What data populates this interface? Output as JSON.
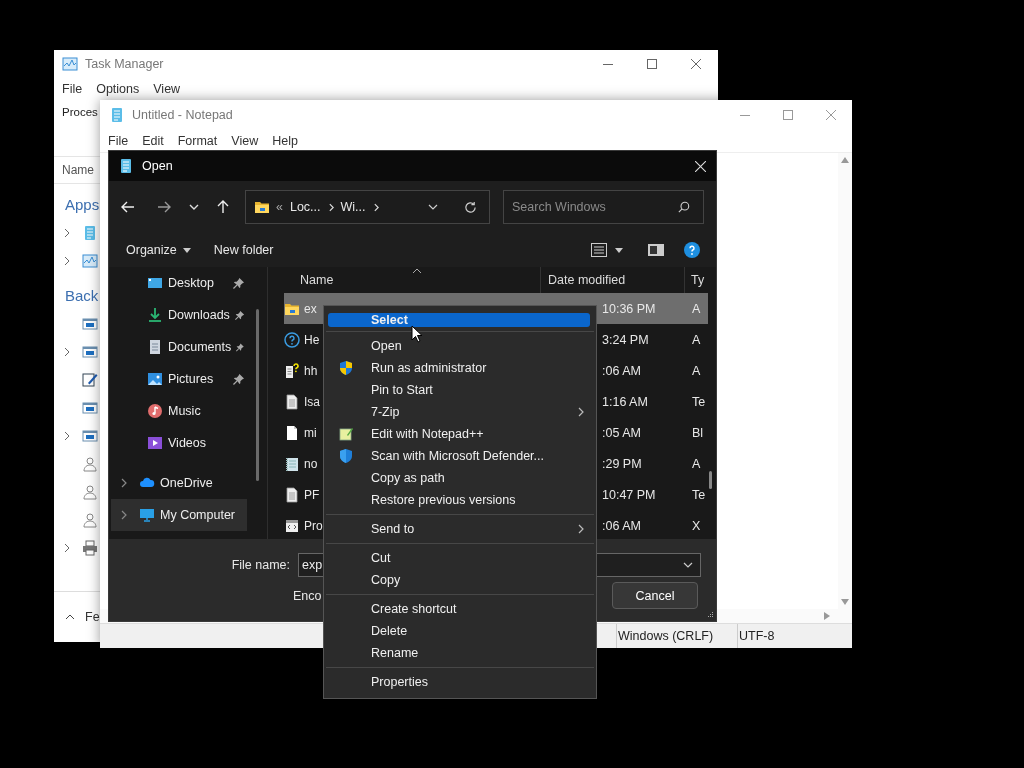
{
  "task_manager": {
    "title": "Task Manager",
    "menu": [
      "File",
      "Options",
      "View"
    ],
    "tab": "Proces",
    "column": "Name",
    "sections": [
      {
        "title": "Apps",
        "rows": [
          {
            "kind": "notepad",
            "expandable": true
          },
          {
            "kind": "chart",
            "expandable": true
          }
        ]
      },
      {
        "title": "Back",
        "rows": [
          {
            "kind": "window",
            "expandable": false
          },
          {
            "kind": "window",
            "expandable": true
          },
          {
            "kind": "editor",
            "expandable": false
          },
          {
            "kind": "window",
            "expandable": false
          },
          {
            "kind": "window",
            "expandable": true
          },
          {
            "kind": "user",
            "expandable": false
          },
          {
            "kind": "user",
            "expandable": false
          },
          {
            "kind": "user",
            "expandable": false
          },
          {
            "kind": "printer",
            "expandable": true
          }
        ]
      }
    ],
    "footer": "Fe"
  },
  "notepad": {
    "title": "Untitled - Notepad",
    "menu": [
      "File",
      "Edit",
      "Format",
      "View",
      "Help"
    ],
    "status": [
      "Windows (CRLF)",
      "UTF-8"
    ]
  },
  "open_dialog": {
    "title": "Open",
    "address": {
      "prefix": "«",
      "segments": [
        "Loc...",
        "Wi..."
      ]
    },
    "search": {
      "placeholder": "Search Windows"
    },
    "toolbar": {
      "organize": "Organize",
      "new_folder": "New folder"
    },
    "nav": [
      {
        "label": "Desktop",
        "kind": "desktop",
        "pinned": true,
        "expandable": false,
        "selected": false
      },
      {
        "label": "Downloads",
        "kind": "downloads",
        "pinned": true,
        "expandable": false,
        "selected": false
      },
      {
        "label": "Documents",
        "kind": "documents",
        "pinned": true,
        "expandable": false,
        "selected": false
      },
      {
        "label": "Pictures",
        "kind": "pictures",
        "pinned": true,
        "expandable": false,
        "selected": false
      },
      {
        "label": "Music",
        "kind": "music",
        "pinned": false,
        "expandable": false,
        "selected": false
      },
      {
        "label": "Videos",
        "kind": "videos",
        "pinned": false,
        "expandable": false,
        "selected": false
      },
      {
        "label": "OneDrive",
        "kind": "cloud",
        "pinned": false,
        "expandable": true,
        "selected": false
      },
      {
        "label": "My Computer",
        "kind": "computer",
        "pinned": false,
        "expandable": true,
        "selected": true
      }
    ],
    "columns": [
      "Name",
      "Date modified",
      "Ty"
    ],
    "files": [
      {
        "name": "ex",
        "date": "10:36 PM",
        "type": "A",
        "kind": "folder",
        "selected": true
      },
      {
        "name": "He",
        "date": "3:24 PM",
        "type": "A",
        "kind": "help",
        "selected": false
      },
      {
        "name": "hh",
        "date": ":06 AM",
        "type": "A",
        "kind": "helpfile",
        "selected": false
      },
      {
        "name": "Isa",
        "date": "1:16 AM",
        "type": "Te",
        "kind": "text",
        "selected": false
      },
      {
        "name": "mi",
        "date": ":05 AM",
        "type": "Bl",
        "kind": "blank",
        "selected": false
      },
      {
        "name": "no",
        "date": ":29 PM",
        "type": "A",
        "kind": "notepadfile",
        "selected": false
      },
      {
        "name": "PF",
        "date": "10:47 PM",
        "type": "Te",
        "kind": "text",
        "selected": false
      },
      {
        "name": "Pro",
        "date": ":06 AM",
        "type": "X",
        "kind": "xml",
        "selected": false
      }
    ],
    "file_name": {
      "label": "File name:",
      "value": "exp"
    },
    "encoding_label": "Enco",
    "cancel": "Cancel"
  },
  "context_menu": {
    "groups": [
      [
        {
          "label": "Select",
          "kind": "plain",
          "selected": true,
          "submenu": false
        }
      ],
      [
        {
          "label": "Open",
          "kind": "plain",
          "selected": false,
          "submenu": false
        },
        {
          "label": "Run as administrator",
          "kind": "shield",
          "selected": false,
          "submenu": false
        },
        {
          "label": "Pin to Start",
          "kind": "plain",
          "selected": false,
          "submenu": false
        },
        {
          "label": "7-Zip",
          "kind": "plain",
          "selected": false,
          "submenu": true
        },
        {
          "label": "Edit with Notepad++",
          "kind": "notepadpp",
          "selected": false,
          "submenu": false
        },
        {
          "label": "Scan with Microsoft Defender...",
          "kind": "defender",
          "selected": false,
          "submenu": false
        },
        {
          "label": "Copy as path",
          "kind": "plain",
          "selected": false,
          "submenu": false
        },
        {
          "label": "Restore previous versions",
          "kind": "plain",
          "selected": false,
          "submenu": false
        }
      ],
      [
        {
          "label": "Send to",
          "kind": "plain",
          "selected": false,
          "submenu": true
        }
      ],
      [
        {
          "label": "Cut",
          "kind": "plain",
          "selected": false,
          "submenu": false
        },
        {
          "label": "Copy",
          "kind": "plain",
          "selected": false,
          "submenu": false
        }
      ],
      [
        {
          "label": "Create shortcut",
          "kind": "plain",
          "selected": false,
          "submenu": false
        },
        {
          "label": "Delete",
          "kind": "plain",
          "selected": false,
          "submenu": false
        },
        {
          "label": "Rename",
          "kind": "plain",
          "selected": false,
          "submenu": false
        }
      ],
      [
        {
          "label": "Properties",
          "kind": "plain",
          "selected": false,
          "submenu": false
        }
      ]
    ]
  }
}
